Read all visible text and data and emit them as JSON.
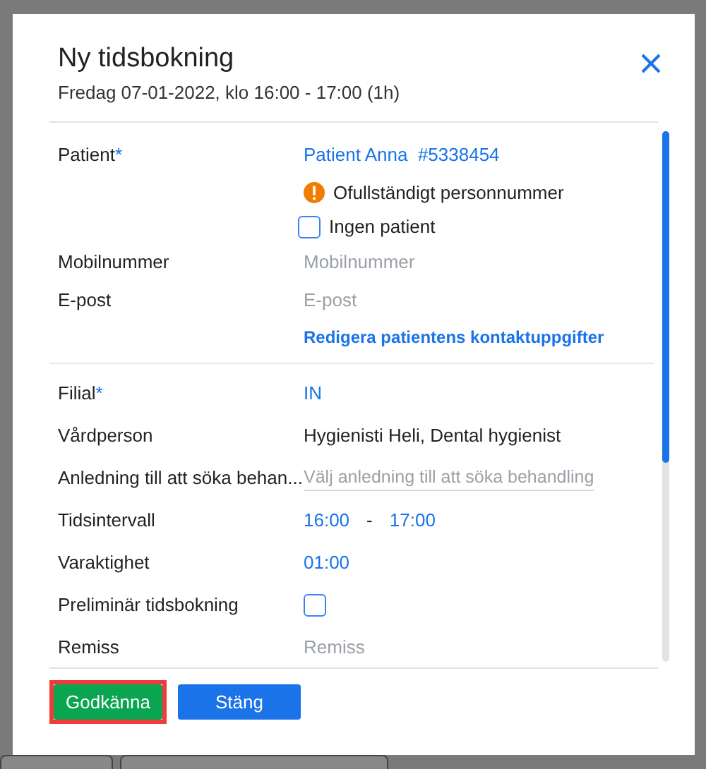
{
  "dialog": {
    "title": "Ny tidsbokning",
    "subtitle": "Fredag 07-01-2022, klo 16:00 - 17:00 (1h)"
  },
  "sections": [
    {
      "rows": [
        {
          "kind": "link",
          "label": "Patient",
          "required_mark": "*",
          "value": "Patient Anna  #5338454"
        },
        {
          "kind": "warning",
          "text": "Ofullständigt personnummer"
        },
        {
          "kind": "checkbox",
          "text": "Ingen patient",
          "checked": false
        },
        {
          "kind": "field",
          "label": "Mobilnummer",
          "placeholder": "Mobilnummer"
        },
        {
          "kind": "field",
          "label": "E-post",
          "placeholder": "E-post"
        },
        {
          "kind": "action",
          "text": "Redigera patientens kontaktuppgifter"
        }
      ]
    },
    {
      "rows": [
        {
          "kind": "link",
          "label": "Filial",
          "required_mark": "*",
          "value": "IN"
        },
        {
          "kind": "text",
          "label": "Vårdperson",
          "value": "Hygienisti Heli, Dental hygienist"
        },
        {
          "kind": "select",
          "label": "Anledning till att söka behan...",
          "placeholder": "Välj anledning till att söka behandling"
        },
        {
          "kind": "range",
          "label": "Tidsintervall",
          "from": "16:00",
          "separator": "-",
          "to": "17:00"
        },
        {
          "kind": "link",
          "label": "Varaktighet",
          "value": "01:00"
        },
        {
          "kind": "labeled_checkbox",
          "label": "Preliminär tidsbokning",
          "checked": false
        },
        {
          "kind": "field",
          "label": "Remiss",
          "placeholder": "Remiss"
        }
      ]
    }
  ],
  "buttons": [
    {
      "label": "Godkänna",
      "kind": "primary",
      "highlighted": true
    },
    {
      "label": "Stäng",
      "kind": "secondary",
      "highlighted": false
    }
  ]
}
